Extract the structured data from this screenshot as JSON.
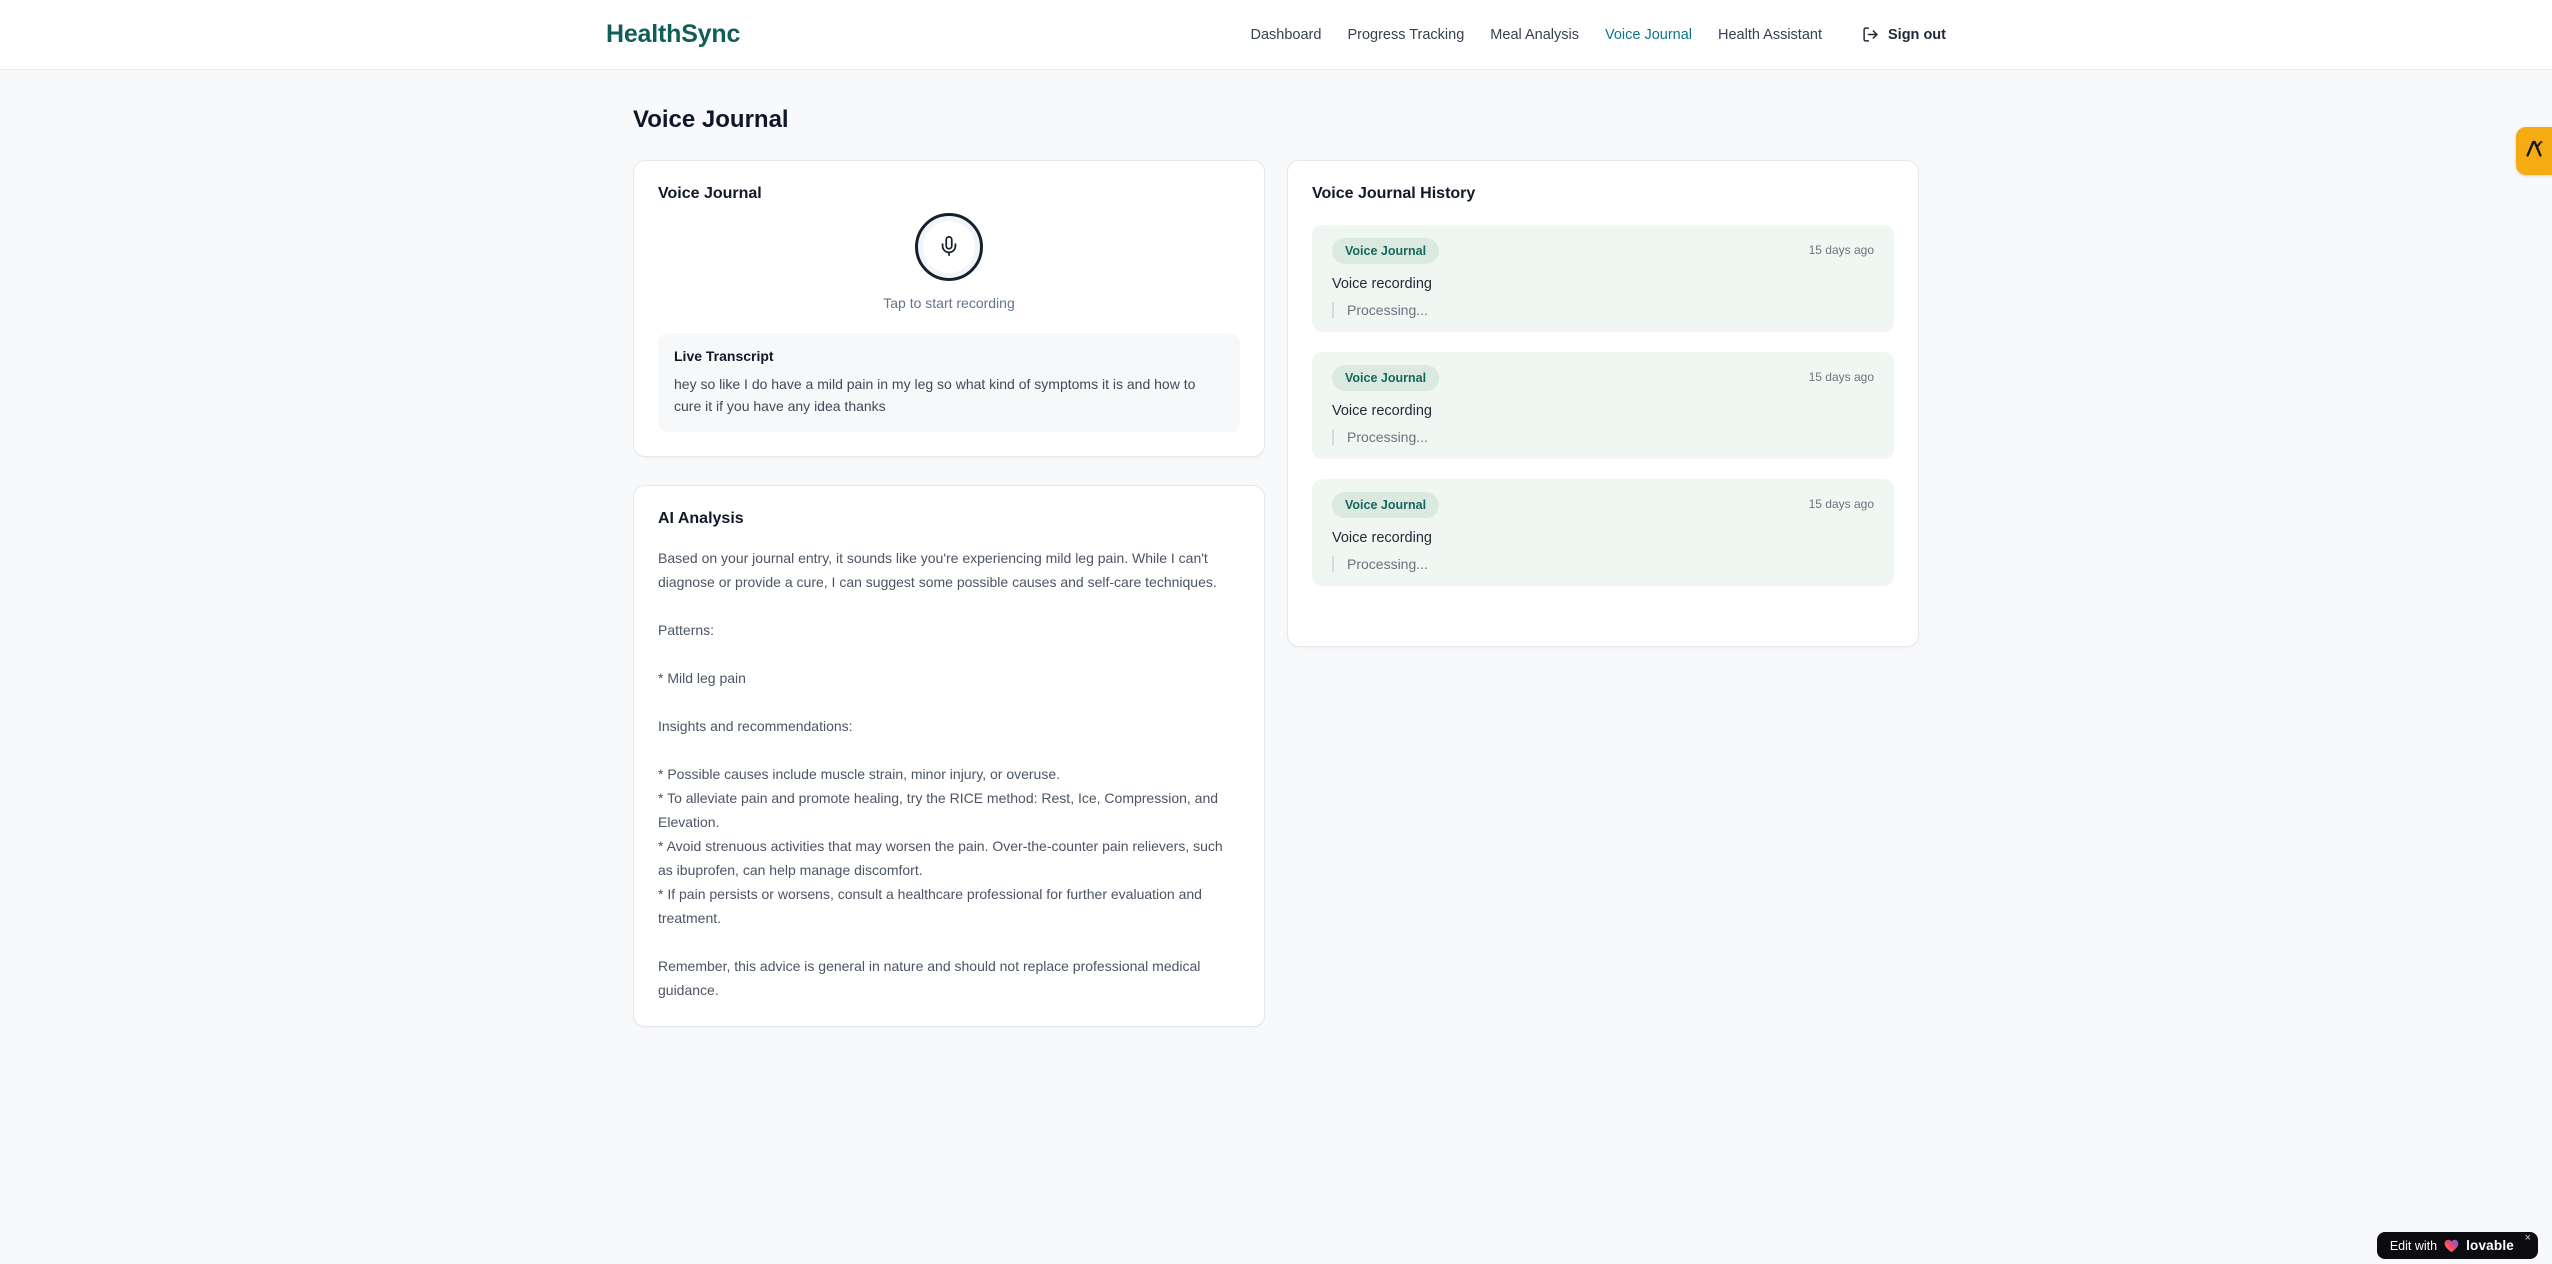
{
  "header": {
    "logo": "HealthSync",
    "nav": [
      {
        "label": "Dashboard"
      },
      {
        "label": "Progress Tracking"
      },
      {
        "label": "Meal Analysis"
      },
      {
        "label": "Voice Journal"
      },
      {
        "label": "Health Assistant"
      }
    ],
    "sign_out_label": "Sign out"
  },
  "page": {
    "title": "Voice Journal"
  },
  "recorder_card": {
    "title": "Voice Journal",
    "tap_label": "Tap to start recording",
    "transcript_title": "Live Transcript",
    "transcript_text": "hey so like I do have a mild pain in my leg so what kind of symptoms it is and how to cure it if you have any idea thanks"
  },
  "analysis_card": {
    "title": "AI Analysis",
    "body": "Based on your journal entry, it sounds like you're experiencing mild leg pain. While I can't diagnose or provide a cure, I can suggest some possible causes and self-care techniques.\n\nPatterns:\n\n* Mild leg pain\n\nInsights and recommendations:\n\n* Possible causes include muscle strain, minor injury, or overuse.\n* To alleviate pain and promote healing, try the RICE method: Rest, Ice, Compression, and Elevation.\n* Avoid strenuous activities that may worsen the pain. Over-the-counter pain relievers, such as ibuprofen, can help manage discomfort.\n* If pain persists or worsens, consult a healthcare professional for further evaluation and treatment.\n\nRemember, this advice is general in nature and should not replace professional medical guidance."
  },
  "history_card": {
    "title": "Voice Journal History",
    "entries": [
      {
        "badge": "Voice Journal",
        "time": "15 days ago",
        "summary": "Voice recording",
        "status": "Processing..."
      },
      {
        "badge": "Voice Journal",
        "time": "15 days ago",
        "summary": "Voice recording",
        "status": "Processing..."
      },
      {
        "badge": "Voice Journal",
        "time": "15 days ago",
        "summary": "Voice recording",
        "status": "Processing..."
      }
    ]
  },
  "floating": {
    "edit_prefix": "Edit with",
    "edit_brand": "lovable",
    "close": "×"
  },
  "colors": {
    "brand_teal": "#115e59",
    "nav_active": "#0e7490",
    "entry_bg": "#f0f7f2",
    "entry_badge_bg": "#dce9e0",
    "entry_badge_text": "#14695e",
    "side_tab_amber": "#f5ac12",
    "lovable_badge_bg": "#0c0c10",
    "page_bg": "#f8f9fb"
  }
}
